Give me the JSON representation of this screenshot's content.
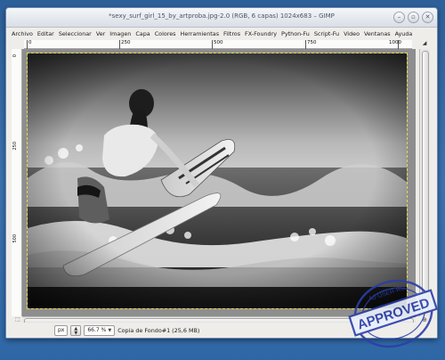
{
  "window": {
    "title": "*sexy_surf_girl_15_by_artproba.jpg-2.0 (RGB, 6 capas) 1024x683 – GIMP"
  },
  "menubar": {
    "items": [
      {
        "label": "Archivo"
      },
      {
        "label": "Editar"
      },
      {
        "label": "Seleccionar"
      },
      {
        "label": "Ver"
      },
      {
        "label": "Imagen"
      },
      {
        "label": "Capa"
      },
      {
        "label": "Colores"
      },
      {
        "label": "Herramientas"
      },
      {
        "label": "Filtros"
      },
      {
        "label": "FX-Foundry"
      },
      {
        "label": "Python-Fu"
      },
      {
        "label": "Script-Fu"
      },
      {
        "label": "Video"
      },
      {
        "label": "Ventanas"
      },
      {
        "label": "Ayuda"
      }
    ]
  },
  "ruler": {
    "h_labels": [
      "0",
      "250",
      "500",
      "750",
      "1000"
    ],
    "v_labels": [
      "0",
      "250",
      "500"
    ]
  },
  "statusbar": {
    "unit": "px",
    "zoom": "66.7 %",
    "layer_info": "Copia de Fondo#1 (25,6 MB)"
  },
  "watermark": {
    "text": "APPROVED",
    "subtext": "AJ·USER·RU"
  }
}
